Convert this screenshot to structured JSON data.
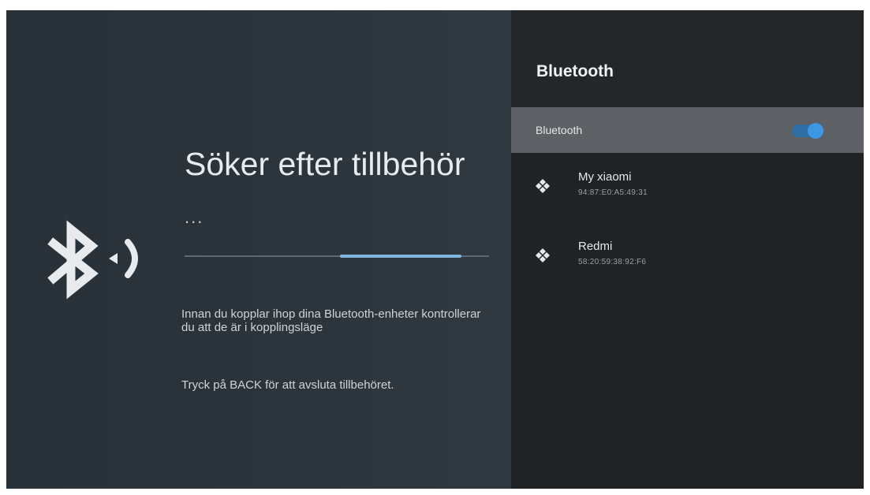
{
  "left": {
    "title": "Söker efter tillbehör",
    "ellipsis": "...",
    "progress": {
      "start_fraction": 0.51,
      "end_fraction": 0.91
    },
    "info_text": "Innan du kopplar ihop dina Bluetooth-enheter kontrollerar du att de är i kopplingsläge",
    "back_hint": "Tryck på BACK för att avsluta tillbehöret.",
    "icon": "bluetooth-searching-icon"
  },
  "panel": {
    "title": "Bluetooth",
    "toggle": {
      "label": "Bluetooth",
      "state": "on"
    },
    "devices": [
      {
        "name": "My xiaomi",
        "address": "94:87:E0:A5:49:31",
        "icon": "gamepad-icon"
      },
      {
        "name": "Redmi",
        "address": "58:20:59:38:92:F6",
        "icon": "gamepad-icon"
      }
    ]
  },
  "colors": {
    "accent": "#3f97e4",
    "progress": "#7fb6df",
    "left_background": "#2c343c",
    "panel_background": "#202224",
    "focused_row": "#5d6064"
  }
}
